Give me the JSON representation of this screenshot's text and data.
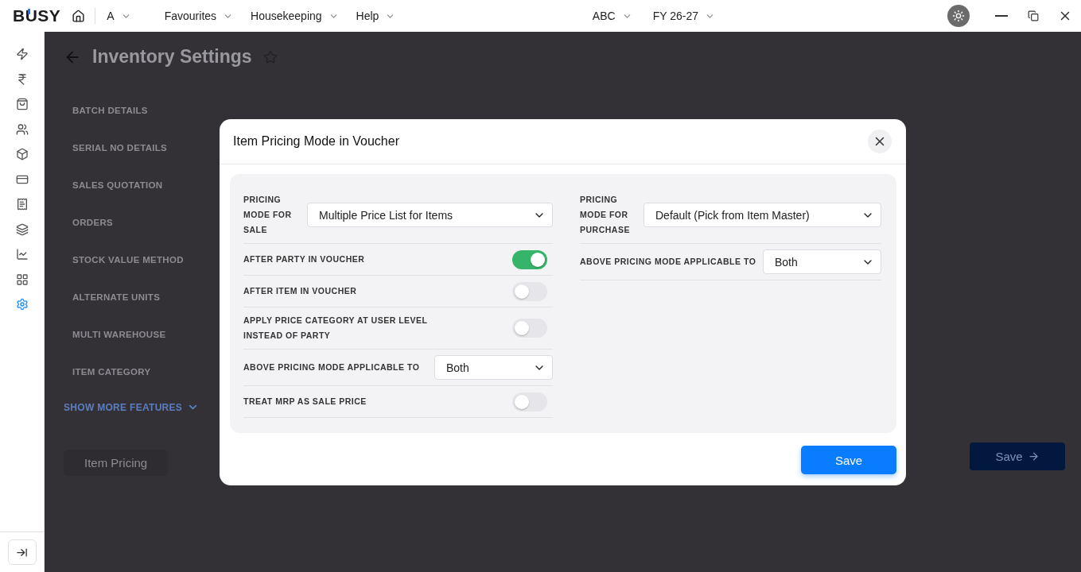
{
  "topbar": {
    "logo": "BUSY",
    "company_menu": "A",
    "menus": [
      "Favourites",
      "Housekeeping",
      "Help"
    ],
    "company": "ABC",
    "year": "FY 26-27"
  },
  "sidebar": {
    "items": [
      {
        "selected": false
      },
      {
        "selected": false
      },
      {
        "selected": false
      },
      {
        "selected": false
      },
      {
        "selected": false
      },
      {
        "selected": false
      },
      {
        "selected": false
      },
      {
        "selected": false
      },
      {
        "selected": false
      },
      {
        "selected": false
      },
      {
        "selected": true
      }
    ]
  },
  "page": {
    "title": "Inventory Settings",
    "features": [
      "BATCH DETAILS",
      "SERIAL NO DETAILS",
      "SALES QUOTATION",
      "ORDERS",
      "STOCK VALUE METHOD",
      "ALTERNATE UNITS",
      "MULTI WAREHOUSE",
      "ITEM CATEGORY"
    ],
    "show_more": "SHOW MORE FEATURES",
    "item_pricing": "Item Pricing",
    "save": "Save"
  },
  "dialog": {
    "title": "Item Pricing Mode in Voucher",
    "left": [
      {
        "kind": "select",
        "label": "PRICING MODE FOR SALE",
        "value": "Multiple Price List for Items",
        "narrow": true
      },
      {
        "kind": "toggle",
        "label": "AFTER PARTY IN VOUCHER",
        "on": true
      },
      {
        "kind": "toggle",
        "label": "AFTER ITEM IN VOUCHER",
        "on": false
      },
      {
        "kind": "toggle",
        "label": "APPLY PRICE CATEGORY AT USER LEVEL INSTEAD OF PARTY",
        "on": false
      },
      {
        "kind": "select",
        "label": "ABOVE PRICING MODE APPLICABLE TO",
        "value": "Both",
        "narrow": false
      },
      {
        "kind": "toggle",
        "label": "TREAT MRP AS SALE PRICE",
        "on": false
      }
    ],
    "right": [
      {
        "kind": "select",
        "label": "PRICING MODE FOR PURCHASE",
        "value": "Default (Pick from Item Master)",
        "narrow": true
      },
      {
        "kind": "select",
        "label": "ABOVE PRICING MODE APPLICABLE TO",
        "value": "Both",
        "narrow": false
      }
    ],
    "save": "Save"
  }
}
